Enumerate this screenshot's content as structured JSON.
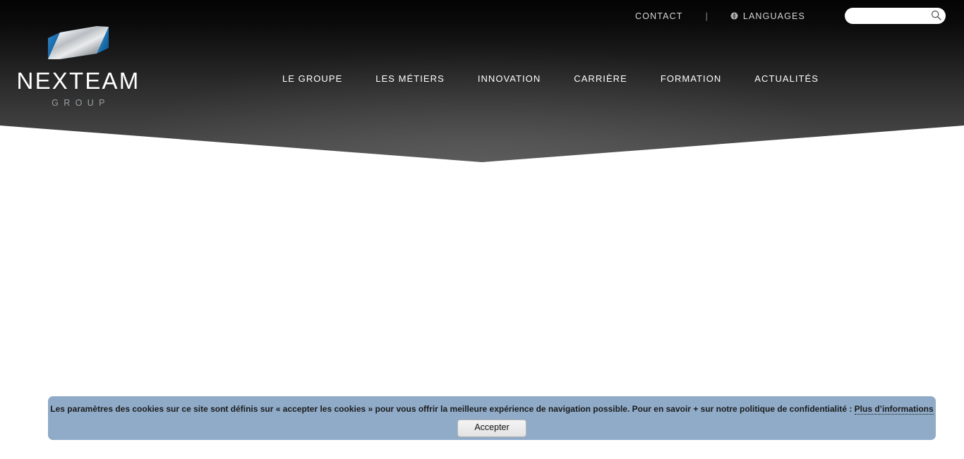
{
  "topbar": {
    "contact_label": "CONTACT",
    "separator": "|",
    "languages_label": "LANGUAGES",
    "globe_icon": "globe-icon",
    "search_placeholder": "",
    "search_value": "",
    "search_icon": "search-icon"
  },
  "logo": {
    "wordmark": "NEXTEAM",
    "subtitle": "GROUP",
    "mark_icon": "nexteam-n-logo-icon",
    "blue": "#1b6cab",
    "blue_dark": "#0d4f86",
    "silver_light": "#f2f2f2",
    "silver_dark": "#8d9196"
  },
  "nav": {
    "items": [
      {
        "label": "LE GROUPE"
      },
      {
        "label": "LES MÉTIERS"
      },
      {
        "label": "INNOVATION"
      },
      {
        "label": "CARRIÈRE"
      },
      {
        "label": "FORMATION"
      },
      {
        "label": "ACTUALITÉS"
      }
    ]
  },
  "cookie": {
    "text_before_link": "Les paramètres des cookies sur ce site sont définis sur « accepter les cookies » pour vous offrir la meilleure expérience de navigation possible. Pour en savoir + sur notre politique de confidentialité : ",
    "link_label": "Plus d’informations",
    "accept_label": "Accepter",
    "background": "#8fabc8"
  },
  "theme": {
    "header_top": "#040404",
    "header_bottom": "#4b4b4b",
    "page_background": "#ffffff",
    "nav_text": "#ffffff",
    "topbar_text": "#d6d6d6"
  }
}
